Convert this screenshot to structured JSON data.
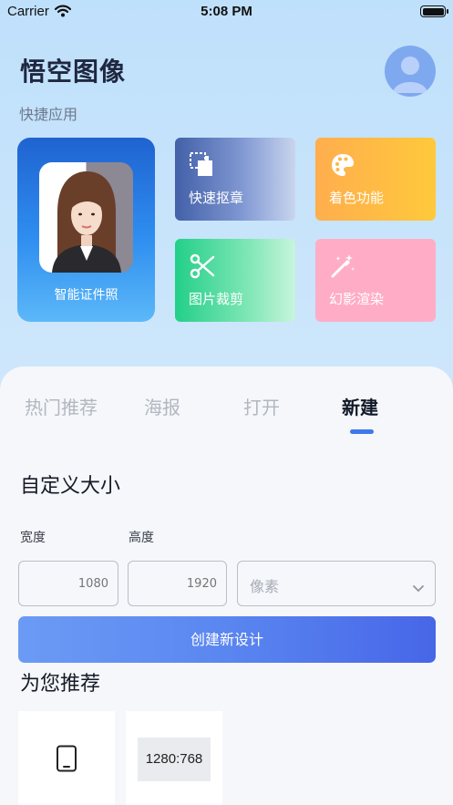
{
  "status_bar": {
    "carrier": "Carrier",
    "time": "5:08 PM",
    "icons": [
      "wifi-icon",
      "battery-icon"
    ]
  },
  "header": {
    "app_title": "悟空图像",
    "avatar_icon": "user-avatar-icon"
  },
  "quick_apps": {
    "title": "快捷应用",
    "id_photo": {
      "label": "智能证件照",
      "icon": "portrait-photo"
    },
    "tiles": [
      {
        "label": "快速抠章",
        "icon": "cutout-icon"
      },
      {
        "label": "着色功能",
        "icon": "palette-icon"
      },
      {
        "label": "图片裁剪",
        "icon": "scissors-icon"
      },
      {
        "label": "幻影渲染",
        "icon": "magic-wand-icon"
      }
    ]
  },
  "tabs": [
    {
      "label": "热门推荐",
      "active": false
    },
    {
      "label": "海报",
      "active": false
    },
    {
      "label": "打开",
      "active": false
    },
    {
      "label": "新建",
      "active": true
    }
  ],
  "custom_size": {
    "title": "自定义大小",
    "width_label": "宽度",
    "height_label": "高度",
    "width_placeholder": "1080",
    "height_placeholder": "1920",
    "unit": "像素",
    "create_button": "创建新设计"
  },
  "recommend": {
    "title": "为您推荐",
    "cards": [
      {
        "icon": "tablet-icon"
      },
      {
        "label": "1280:768"
      }
    ]
  },
  "colors": {
    "accent": "#3f78ea",
    "id_card_blue": "#1f63d1",
    "tile_orange": "#ffc93b",
    "tile_green": "#23cf8a",
    "tile_pink": "#ffadc6"
  }
}
